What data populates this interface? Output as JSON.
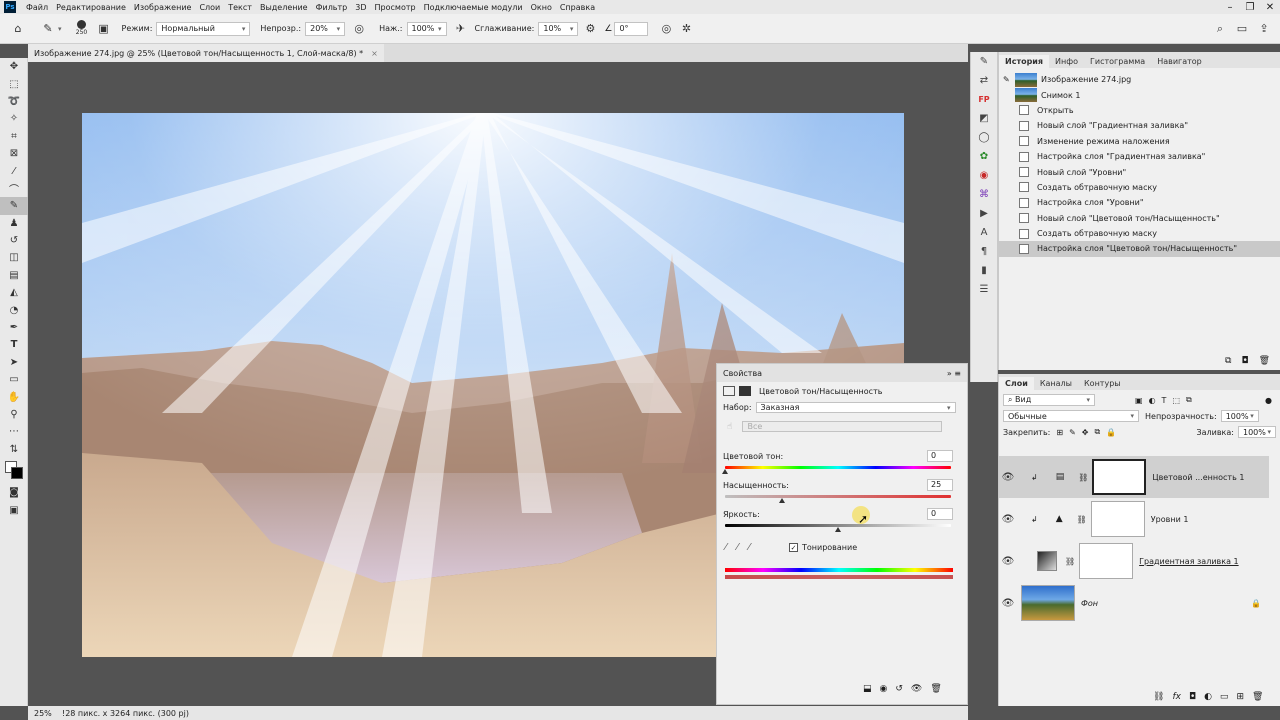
{
  "menu": {
    "logo": "Ps",
    "items": [
      "Файл",
      "Редактирование",
      "Изображение",
      "Слои",
      "Текст",
      "Выделение",
      "Фильтр",
      "3D",
      "Просмотр",
      "Подключаемые модули",
      "Окно",
      "Справка"
    ]
  },
  "options": {
    "brush_size": "250",
    "mode_label": "Режим:",
    "mode_value": "Нормальный",
    "opacity_label": "Непрозр.:",
    "opacity_value": "20%",
    "flow_label": "Наж.:",
    "flow_value": "100%",
    "smoothing_label": "Сглаживание:",
    "smoothing_value": "10%",
    "angle_value": "0°"
  },
  "document": {
    "tab_title": "Изображение 274.jpg @ 25% (Цветовой тон/Насыщенность 1, Слой-маска/8) *",
    "tab_close": "×"
  },
  "status": {
    "zoom": "25%",
    "dimensions": "!28 пикс. x 3264 пикс. (300 pj)"
  },
  "properties": {
    "title": "Свойства",
    "subtitle": "Цветовой тон/Насыщенность",
    "preset_label": "Набор:",
    "preset_value": "Заказная",
    "channel_value": "Все",
    "hue_label": "Цветовой тон:",
    "hue_value": "0",
    "saturation_label": "Насыщенность:",
    "saturation_value": "25",
    "lightness_label": "Яркость:",
    "lightness_value": "0",
    "colorize_label": "Тонирование",
    "colorize_checked": true
  },
  "history": {
    "tabs": [
      "История",
      "Инфо",
      "Гистограмма",
      "Навигатор"
    ],
    "snapshots": [
      "Изображение 274.jpg",
      "Снимок 1"
    ],
    "steps": [
      "Открыть",
      "Новый слой \"Градиентная заливка\"",
      "Изменение режима наложения",
      "Настройка слоя \"Градиентная заливка\"",
      "Новый слой \"Уровни\"",
      "Создать обтравочную маску",
      "Настройка слоя \"Уровни\"",
      "Новый слой \"Цветовой тон/Насыщенность\"",
      "Создать обтравочную маску",
      "Настройка слоя \"Цветовой тон/Насыщенность\""
    ]
  },
  "layers_panel": {
    "tabs": [
      "Слои",
      "Каналы",
      "Контуры"
    ],
    "filter_value": "Вид",
    "blend_mode": "Обычные",
    "opacity_label": "Непрозрачность:",
    "opacity_value": "100%",
    "lock_label": "Закрепить:",
    "fill_label": "Заливка:",
    "fill_value": "100%",
    "layers": [
      {
        "name": "Цветовой ...енность 1"
      },
      {
        "name": "Уровни 1"
      },
      {
        "name": "Градиентная заливка 1"
      },
      {
        "name": "Фон"
      }
    ]
  },
  "colors": {
    "accent": "#31a8ff",
    "panel_bg": "#f0f0f0",
    "canvas_bg": "#535353"
  }
}
